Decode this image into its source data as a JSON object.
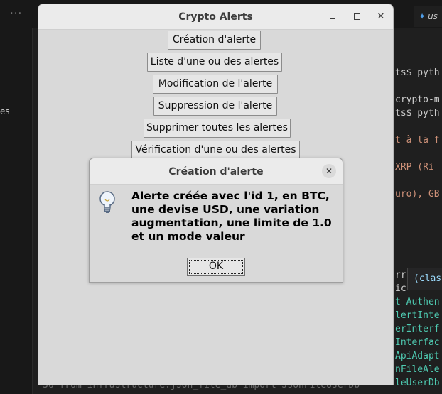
{
  "background": {
    "menu_dots": "···",
    "sidebar_fragment": "es",
    "tab": {
      "icon": "python-icon",
      "label": "us"
    },
    "code_lines": [
      {
        "text": "ts$ pyth",
        "color": "#cccccc"
      },
      {
        "text": "crypto-m",
        "color": "#cccccc"
      },
      {
        "text": "ts$ pyth",
        "color": "#cccccc"
      },
      {
        "text": "t à la f",
        "color": "#ce9178"
      },
      {
        "text": " XRP (Ri",
        "color": "#ce9178"
      },
      {
        "text": "uro), GB",
        "color": "#ce9178"
      },
      {
        "text": "rr",
        "color": "#cccccc"
      },
      {
        "text": "ic",
        "color": "#cccccc"
      },
      {
        "text": "t Authen",
        "color": "#4ec9b0"
      },
      {
        "text": "lertInte",
        "color": "#4ec9b0"
      },
      {
        "text": "erInterf",
        "color": "#4ec9b0"
      },
      {
        "text": "Interfac",
        "color": "#4ec9b0"
      },
      {
        "text": "ApiAdapt",
        "color": "#4ec9b0"
      },
      {
        "text": "nFileAle",
        "color": "#4ec9b0"
      },
      {
        "text": "leUserDb",
        "color": "#4ec9b0"
      }
    ],
    "tooltip": "(clas",
    "bottom_line": "36   from infrastructure.json_file_db import JsonFileUserDb"
  },
  "window": {
    "title": "Crypto Alerts",
    "buttons": [
      {
        "label": "Création d'alerte"
      },
      {
        "label": "Liste d'une ou des alertes"
      },
      {
        "label": "Modification de l'alerte"
      },
      {
        "label": "Suppression de l'alerte"
      },
      {
        "label": "Supprimer toutes les alertes"
      },
      {
        "label": "Vérification d'une ou des alertes"
      }
    ]
  },
  "dialog": {
    "title": "Création d'alerte",
    "icon": "lightbulb-icon",
    "message": "Alerte créée avec l'id 1, en BTC, une devise USD, une variation augmentation, une limite de 1.0 et un mode valeur",
    "ok_label": "OK"
  }
}
